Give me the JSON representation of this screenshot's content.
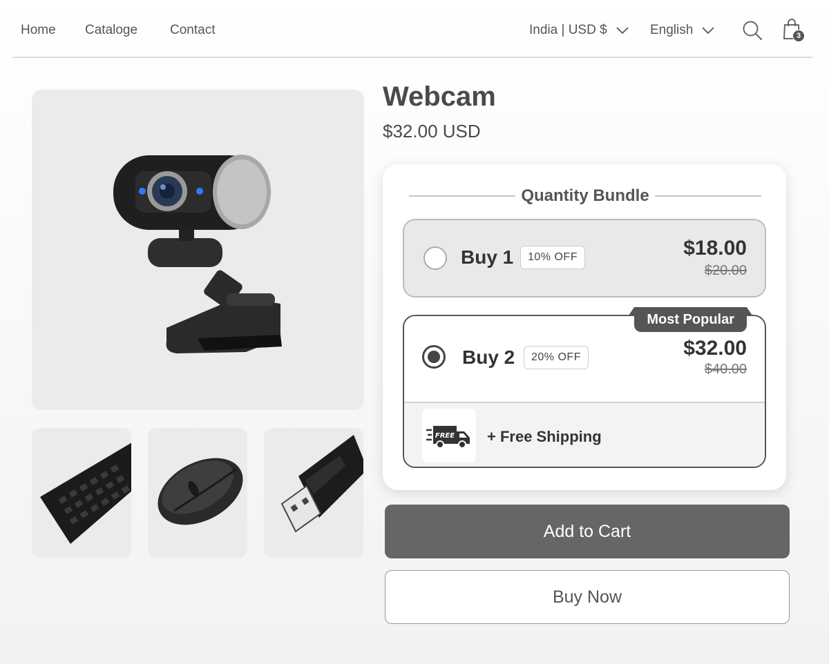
{
  "nav": {
    "links": [
      "Home",
      "Cataloge",
      "Contact"
    ],
    "region": "India | USD $",
    "language": "English",
    "cart_count": "3"
  },
  "product": {
    "title": "Webcam",
    "price": "$32.00 USD"
  },
  "bundle": {
    "heading": "Quantity Bundle",
    "options": [
      {
        "label": "Buy 1",
        "discount": "10% OFF",
        "price": "$18.00",
        "compare_price": "$20.00",
        "selected": false
      },
      {
        "label": "Buy 2",
        "discount": "20% OFF",
        "price": "$32.00",
        "compare_price": "$40.00",
        "selected": true,
        "tag": "Most Popular",
        "perk": "+ Free Shipping",
        "perk_icon_text": "FREE"
      }
    ]
  },
  "buttons": {
    "add_to_cart": "Add to Cart",
    "buy_now": "Buy Now"
  },
  "icons": [
    "chevron-down-icon",
    "search-icon",
    "shopping-bag-icon",
    "delivery-truck-icon"
  ],
  "colors": {
    "primary_button": "#666666",
    "selected_border": "#555555",
    "tag_background": "#555555"
  }
}
